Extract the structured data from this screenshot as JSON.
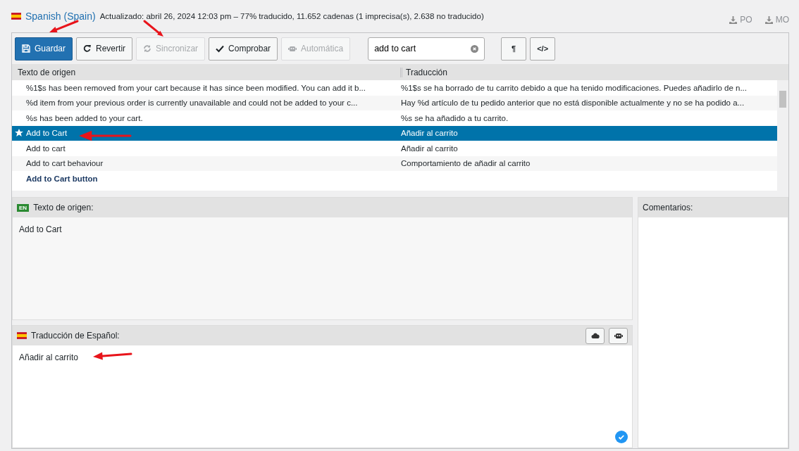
{
  "header": {
    "language": "Spanish (Spain)",
    "status": "Actualizado: abril 26, 2024 12:03 pm – 77% traducido, 11.652 cadenas (1 imprecisa(s), 2.638 no traducido)",
    "downloads": [
      "PO",
      "MO"
    ]
  },
  "toolbar": {
    "buttons": [
      {
        "label": "Guardar",
        "kind": "primary",
        "disabled": false
      },
      {
        "label": "Revertir",
        "kind": "normal",
        "disabled": false
      },
      {
        "label": "Sincronizar",
        "kind": "normal",
        "disabled": true
      },
      {
        "label": "Comprobar",
        "kind": "normal",
        "disabled": false
      },
      {
        "label": "Automática",
        "kind": "normal",
        "disabled": true
      }
    ],
    "search": {
      "value": "add to cart"
    },
    "tools": [
      "¶",
      "</>"
    ]
  },
  "table": {
    "columns": [
      "Texto de origen",
      "Traducción"
    ],
    "rows": [
      {
        "source": "%1$s has been removed from your cart because it has since been modified. You can add it b...",
        "translation": "%1$s se ha borrado de tu carrito debido a que ha tenido modificaciones. Puedes añadirlo de n...",
        "selected": false,
        "starred": false,
        "translated": true
      },
      {
        "source": "%d item from your previous order is currently unavailable and could not be added to your c...",
        "translation": "Hay %d artículo de tu pedido anterior que no está disponible actualmente y no se ha podido a...",
        "selected": false,
        "starred": false,
        "translated": true
      },
      {
        "source": "%s has been added to your cart.",
        "translation": "%s se ha añadido a tu carrito.",
        "selected": false,
        "starred": false,
        "translated": true
      },
      {
        "source": "Add to Cart",
        "translation": "Añadir al carrito",
        "selected": true,
        "starred": true,
        "translated": true
      },
      {
        "source": "Add to cart",
        "translation": "Añadir al carrito",
        "selected": false,
        "starred": false,
        "translated": true
      },
      {
        "source": "Add to cart behaviour",
        "translation": "Comportamiento de añadir al carrito",
        "selected": false,
        "starred": false,
        "translated": true
      },
      {
        "source": "Add to Cart button",
        "selected": false,
        "starred": false,
        "translated": false
      }
    ]
  },
  "source_panel": {
    "badge": "EN",
    "title": "Texto de origen:",
    "text": "Add to Cart"
  },
  "translation_panel": {
    "title": "Traducción de Español:",
    "text": "Añadir al carrito"
  },
  "comments_panel": {
    "title": "Comentarios:"
  }
}
